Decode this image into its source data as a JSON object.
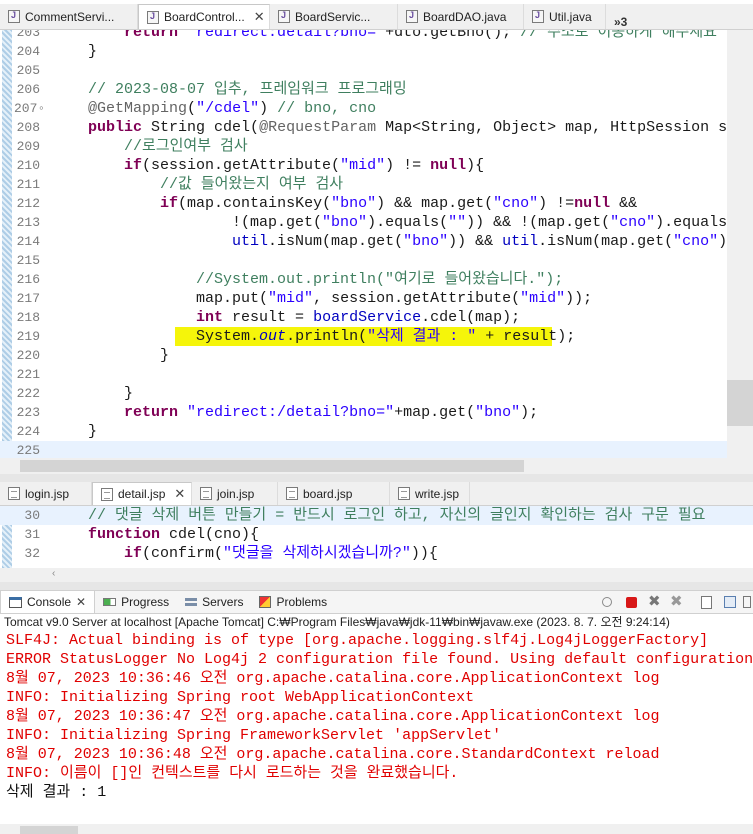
{
  "editor_tabs": [
    {
      "label": "CommentServi...",
      "closable": false,
      "active": false
    },
    {
      "label": "BoardControl...",
      "closable": true,
      "active": true
    },
    {
      "label": "BoardServic...",
      "closable": false,
      "active": false
    },
    {
      "label": "BoardDAO.java",
      "closable": false,
      "active": false
    },
    {
      "label": "Util.java",
      "closable": false,
      "active": false
    }
  ],
  "overflow_count": "»3",
  "java_lines": [
    {
      "n": "203",
      "code": "        return \"redirect:detail?bno=\"+dto.getBno(); // 주소로 이동하게 해주세요"
    },
    {
      "n": "204",
      "code": "    }"
    },
    {
      "n": "205",
      "code": ""
    },
    {
      "n": "206",
      "code": "    // 2023-08-07 입추, 프레임워크 프로그래밍"
    },
    {
      "n": "207◦",
      "code": "    @GetMapping(\"/cdel\") // bno, cno"
    },
    {
      "n": "208",
      "code": "    public String cdel(@RequestParam Map<String, Object> map, HttpSession session) {"
    },
    {
      "n": "209",
      "code": "        //로그인여부 검사"
    },
    {
      "n": "210",
      "code": "        if(session.getAttribute(\"mid\") != null){"
    },
    {
      "n": "211",
      "code": "            //값 들어왔는지 여부 검사"
    },
    {
      "n": "212",
      "code": "            if(map.containsKey(\"bno\") && map.get(\"cno\") !=null &&"
    },
    {
      "n": "213",
      "code": "                    !(map.get(\"bno\").equals(\"\")) && !(map.get(\"cno\").equals(\"\")) &&"
    },
    {
      "n": "214",
      "code": "                    util.isNum(map.get(\"bno\")) && util.isNum(map.get(\"cno\"))) {"
    },
    {
      "n": "215",
      "code": ""
    },
    {
      "n": "216",
      "code": "                //System.out.println(\"여기로 들어왔습니다.\");"
    },
    {
      "n": "217",
      "code": "                map.put(\"mid\", session.getAttribute(\"mid\"));"
    },
    {
      "n": "218",
      "code": "                int result = boardService.cdel(map);"
    },
    {
      "n": "219",
      "code": "                System.out.println(\"삭제 결과 : \" + result);"
    },
    {
      "n": "220",
      "code": "            }"
    },
    {
      "n": "221",
      "code": ""
    },
    {
      "n": "222",
      "code": "        }"
    },
    {
      "n": "223",
      "code": "        return \"redirect:/detail?bno=\"+map.get(\"bno\");"
    },
    {
      "n": "224",
      "code": "    }"
    },
    {
      "n": "225",
      "code": ""
    }
  ],
  "jsp_tabs": [
    {
      "label": "login.jsp",
      "active": false,
      "closable": false
    },
    {
      "label": "detail.jsp",
      "active": true,
      "closable": true
    },
    {
      "label": "join.jsp",
      "active": false,
      "closable": false
    },
    {
      "label": "board.jsp",
      "active": false,
      "closable": false
    },
    {
      "label": "write.jsp",
      "active": false,
      "closable": false
    }
  ],
  "jsp_lines": [
    {
      "n": "30",
      "code": "    // 댓글 삭제 버튼 만들기 = 반드시 로그인 하고, 자신의 글인지 확인하는 검사 구문 필요"
    },
    {
      "n": "31",
      "code": "    function cdel(cno){"
    },
    {
      "n": "32",
      "code": "        if(confirm(\"댓글을 삭제하시겠습니까?\")){"
    }
  ],
  "views": [
    {
      "label": "Console",
      "active": true,
      "closable": true,
      "icon": "console-icon"
    },
    {
      "label": "Progress",
      "active": false,
      "closable": false,
      "icon": "progress-icon"
    },
    {
      "label": "Servers",
      "active": false,
      "closable": false,
      "icon": "servers-icon"
    },
    {
      "label": "Problems",
      "active": false,
      "closable": false,
      "icon": "problems-icon"
    }
  ],
  "console_title": "Tomcat v9.0 Server at localhost [Apache Tomcat] C:₩Program Files₩java₩jdk-11₩bin₩javaw.exe  (2023. 8. 7. 오전 9:24:14)",
  "console_lines": [
    {
      "text": "SLF4J: Actual binding is of type [org.apache.logging.slf4j.Log4jLoggerFactory]",
      "color": "red"
    },
    {
      "text": "ERROR StatusLogger No Log4j 2 configuration file found. Using default configuration (logging o",
      "color": "red"
    },
    {
      "text": "8월 07, 2023 10:36:46 오전 org.apache.catalina.core.ApplicationContext log",
      "color": "red"
    },
    {
      "text": "INFO: Initializing Spring root WebApplicationContext",
      "color": "red"
    },
    {
      "text": "8월 07, 2023 10:36:47 오전 org.apache.catalina.core.ApplicationContext log",
      "color": "red"
    },
    {
      "text": "INFO: Initializing Spring FrameworkServlet 'appServlet'",
      "color": "red"
    },
    {
      "text": "8월 07, 2023 10:36:48 오전 org.apache.catalina.core.StandardContext reload",
      "color": "red"
    },
    {
      "text": "INFO: 이름이 []인 컨텍스트를 다시 로드하는 것을 완료했습니다.",
      "color": "red"
    },
    {
      "text": "삭제 결과 : 1",
      "color": "black"
    }
  ],
  "colors": {
    "highlight": "#f5f50a",
    "error_text": "#e00000",
    "keyword": "#7f0055",
    "string": "#2a00ff",
    "comment": "#3f7f5f",
    "current_line": "#e8f2fe"
  }
}
